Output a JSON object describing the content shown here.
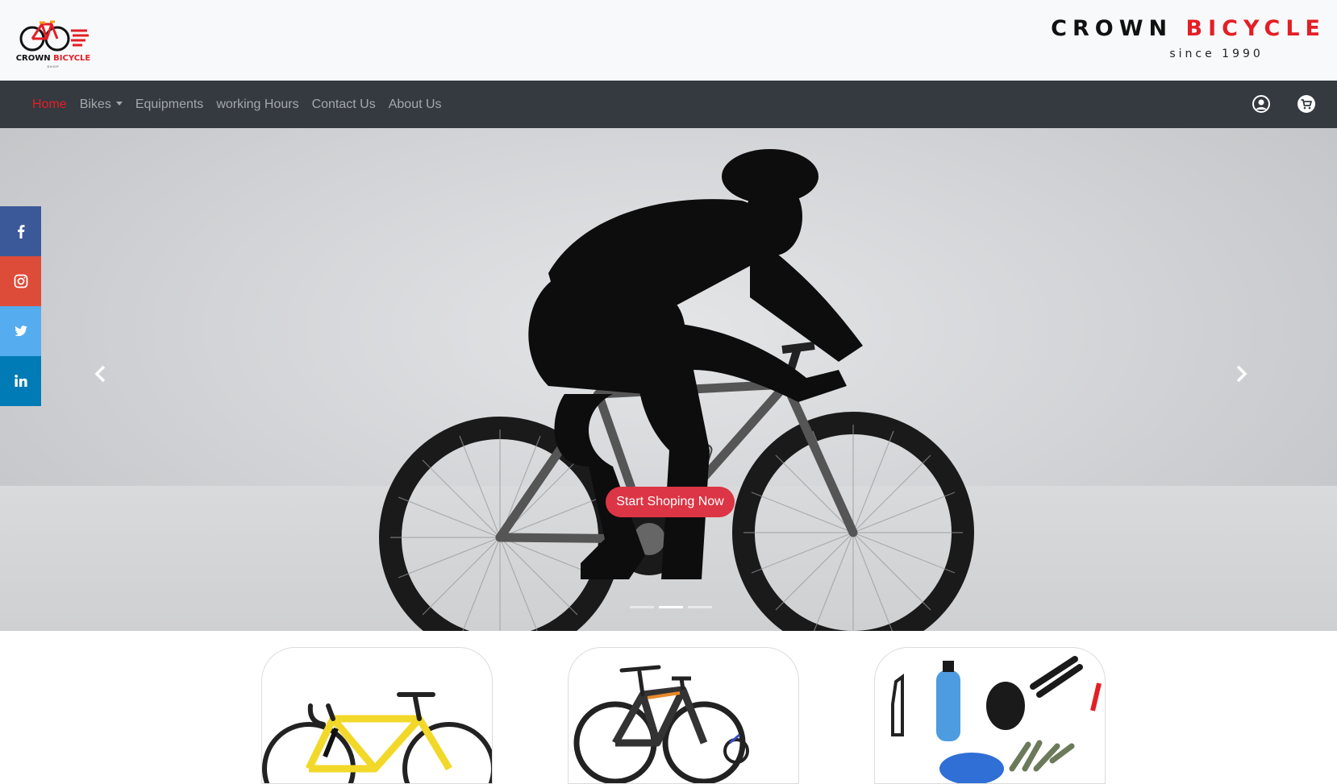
{
  "header": {
    "logo": {
      "word1": "CROWN",
      "word2": "BICYCLE",
      "sub": "SHOP"
    },
    "brand": {
      "word1": "CROWN",
      "word2": "BICYCLE",
      "since": "since 1990"
    }
  },
  "nav": {
    "items": [
      {
        "label": "Home",
        "active": true
      },
      {
        "label": "Bikes",
        "dropdown": true
      },
      {
        "label": "Equipments"
      },
      {
        "label": "working Hours"
      },
      {
        "label": "Contact Us"
      },
      {
        "label": "About Us"
      }
    ],
    "icons": [
      "user-icon",
      "cart-icon"
    ]
  },
  "hero": {
    "cta_label": "Start Shoping Now",
    "slide_count": 3,
    "active_slide": 1
  },
  "social": [
    "facebook-icon",
    "instagram-icon",
    "twitter-icon",
    "linkedin-icon"
  ],
  "colors": {
    "accent_red": "#e41e26",
    "button_red": "#dc3545",
    "navbar": "#343a40",
    "header_bg": "#f8f9fa",
    "facebook": "#3b5998",
    "instagram": "#dd4b39",
    "twitter": "#55acee",
    "linkedin": "#007bb5"
  },
  "cards": [
    {
      "image": "yellow-road-bike"
    },
    {
      "image": "electric-mountain-bike"
    },
    {
      "image": "bike-accessories"
    }
  ]
}
